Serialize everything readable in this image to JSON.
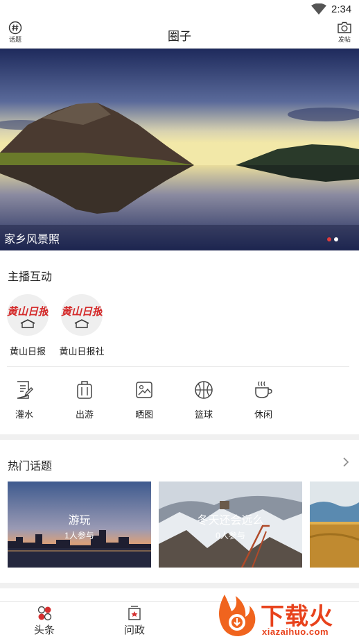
{
  "status_bar": {
    "time": "2:34",
    "wifi_icon": "wifi-icon"
  },
  "header": {
    "title": "圈子",
    "topic_label": "话题",
    "post_label": "发帖"
  },
  "banner": {
    "caption": "家乡风景照",
    "slide_count": 2,
    "active_slide": 1
  },
  "anchor_section": {
    "title": "主播互动",
    "items": [
      {
        "name": "黄山日报",
        "logo_text": "黄山日报"
      },
      {
        "name": "黄山日报社",
        "logo_text": "黄山日报"
      }
    ]
  },
  "categories": [
    {
      "label": "灌水",
      "icon": "edit-note-icon"
    },
    {
      "label": "出游",
      "icon": "suitcase-icon"
    },
    {
      "label": "晒图",
      "icon": "image-icon"
    },
    {
      "label": "篮球",
      "icon": "basketball-icon"
    },
    {
      "label": "休闲",
      "icon": "coffee-cup-icon"
    }
  ],
  "hot_topics": {
    "title": "热门话题",
    "items": [
      {
        "name": "游玩",
        "count": "1人参与"
      },
      {
        "name": "冬天还会远么",
        "count": "0人参与"
      },
      {
        "name": "",
        "count": ""
      }
    ]
  },
  "bottom_nav": {
    "items": [
      {
        "label": "头条",
        "icon": "headlines-icon"
      },
      {
        "label": "问政",
        "icon": "inquiry-icon"
      }
    ]
  },
  "watermark": {
    "text": "下载火",
    "url": "xiazaihuo.com"
  },
  "colors": {
    "accent": "#e03b3b",
    "watermark": "#e8421c",
    "logo_red": "#d42a2a"
  }
}
